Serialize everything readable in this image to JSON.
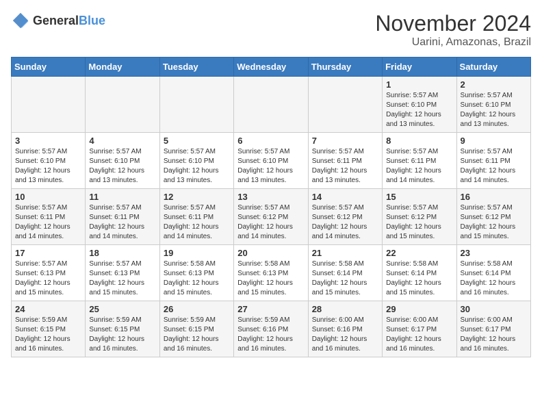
{
  "header": {
    "logo_general": "General",
    "logo_blue": "Blue",
    "month": "November 2024",
    "location": "Uarini, Amazonas, Brazil"
  },
  "weekdays": [
    "Sunday",
    "Monday",
    "Tuesday",
    "Wednesday",
    "Thursday",
    "Friday",
    "Saturday"
  ],
  "weeks": [
    [
      {
        "day": "",
        "info": ""
      },
      {
        "day": "",
        "info": ""
      },
      {
        "day": "",
        "info": ""
      },
      {
        "day": "",
        "info": ""
      },
      {
        "day": "",
        "info": ""
      },
      {
        "day": "1",
        "info": "Sunrise: 5:57 AM\nSunset: 6:10 PM\nDaylight: 12 hours and 13 minutes."
      },
      {
        "day": "2",
        "info": "Sunrise: 5:57 AM\nSunset: 6:10 PM\nDaylight: 12 hours and 13 minutes."
      }
    ],
    [
      {
        "day": "3",
        "info": "Sunrise: 5:57 AM\nSunset: 6:10 PM\nDaylight: 12 hours and 13 minutes."
      },
      {
        "day": "4",
        "info": "Sunrise: 5:57 AM\nSunset: 6:10 PM\nDaylight: 12 hours and 13 minutes."
      },
      {
        "day": "5",
        "info": "Sunrise: 5:57 AM\nSunset: 6:10 PM\nDaylight: 12 hours and 13 minutes."
      },
      {
        "day": "6",
        "info": "Sunrise: 5:57 AM\nSunset: 6:10 PM\nDaylight: 12 hours and 13 minutes."
      },
      {
        "day": "7",
        "info": "Sunrise: 5:57 AM\nSunset: 6:11 PM\nDaylight: 12 hours and 13 minutes."
      },
      {
        "day": "8",
        "info": "Sunrise: 5:57 AM\nSunset: 6:11 PM\nDaylight: 12 hours and 14 minutes."
      },
      {
        "day": "9",
        "info": "Sunrise: 5:57 AM\nSunset: 6:11 PM\nDaylight: 12 hours and 14 minutes."
      }
    ],
    [
      {
        "day": "10",
        "info": "Sunrise: 5:57 AM\nSunset: 6:11 PM\nDaylight: 12 hours and 14 minutes."
      },
      {
        "day": "11",
        "info": "Sunrise: 5:57 AM\nSunset: 6:11 PM\nDaylight: 12 hours and 14 minutes."
      },
      {
        "day": "12",
        "info": "Sunrise: 5:57 AM\nSunset: 6:11 PM\nDaylight: 12 hours and 14 minutes."
      },
      {
        "day": "13",
        "info": "Sunrise: 5:57 AM\nSunset: 6:12 PM\nDaylight: 12 hours and 14 minutes."
      },
      {
        "day": "14",
        "info": "Sunrise: 5:57 AM\nSunset: 6:12 PM\nDaylight: 12 hours and 14 minutes."
      },
      {
        "day": "15",
        "info": "Sunrise: 5:57 AM\nSunset: 6:12 PM\nDaylight: 12 hours and 15 minutes."
      },
      {
        "day": "16",
        "info": "Sunrise: 5:57 AM\nSunset: 6:12 PM\nDaylight: 12 hours and 15 minutes."
      }
    ],
    [
      {
        "day": "17",
        "info": "Sunrise: 5:57 AM\nSunset: 6:13 PM\nDaylight: 12 hours and 15 minutes."
      },
      {
        "day": "18",
        "info": "Sunrise: 5:57 AM\nSunset: 6:13 PM\nDaylight: 12 hours and 15 minutes."
      },
      {
        "day": "19",
        "info": "Sunrise: 5:58 AM\nSunset: 6:13 PM\nDaylight: 12 hours and 15 minutes."
      },
      {
        "day": "20",
        "info": "Sunrise: 5:58 AM\nSunset: 6:13 PM\nDaylight: 12 hours and 15 minutes."
      },
      {
        "day": "21",
        "info": "Sunrise: 5:58 AM\nSunset: 6:14 PM\nDaylight: 12 hours and 15 minutes."
      },
      {
        "day": "22",
        "info": "Sunrise: 5:58 AM\nSunset: 6:14 PM\nDaylight: 12 hours and 15 minutes."
      },
      {
        "day": "23",
        "info": "Sunrise: 5:58 AM\nSunset: 6:14 PM\nDaylight: 12 hours and 16 minutes."
      }
    ],
    [
      {
        "day": "24",
        "info": "Sunrise: 5:59 AM\nSunset: 6:15 PM\nDaylight: 12 hours and 16 minutes."
      },
      {
        "day": "25",
        "info": "Sunrise: 5:59 AM\nSunset: 6:15 PM\nDaylight: 12 hours and 16 minutes."
      },
      {
        "day": "26",
        "info": "Sunrise: 5:59 AM\nSunset: 6:15 PM\nDaylight: 12 hours and 16 minutes."
      },
      {
        "day": "27",
        "info": "Sunrise: 5:59 AM\nSunset: 6:16 PM\nDaylight: 12 hours and 16 minutes."
      },
      {
        "day": "28",
        "info": "Sunrise: 6:00 AM\nSunset: 6:16 PM\nDaylight: 12 hours and 16 minutes."
      },
      {
        "day": "29",
        "info": "Sunrise: 6:00 AM\nSunset: 6:17 PM\nDaylight: 12 hours and 16 minutes."
      },
      {
        "day": "30",
        "info": "Sunrise: 6:00 AM\nSunset: 6:17 PM\nDaylight: 12 hours and 16 minutes."
      }
    ]
  ]
}
